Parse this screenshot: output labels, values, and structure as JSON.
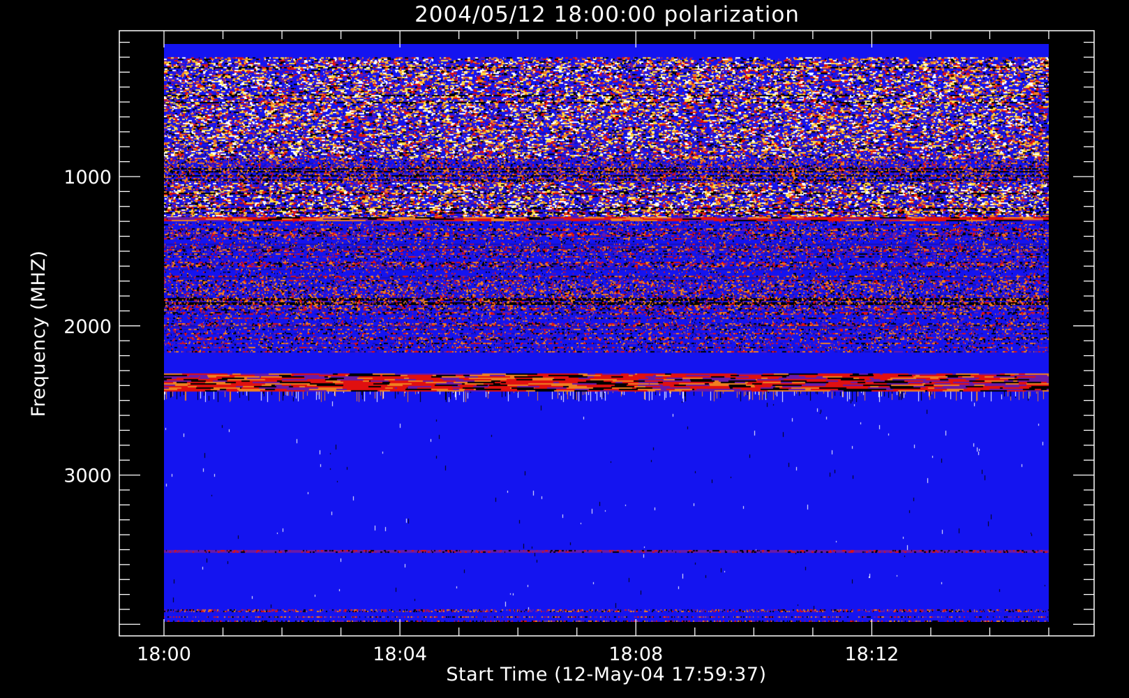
{
  "chart_data": {
    "type": "heatmap",
    "title": "2004/05/12 18:00:00 polarization",
    "xlabel": "Start Time (12-May-04 17:59:37)",
    "ylabel": "Frequency (MHZ)",
    "x_ticks": [
      "18:00",
      "18:04",
      "18:08",
      "18:12"
    ],
    "y_ticks": [
      1000,
      2000,
      3000
    ],
    "xlim_minutes_after_1800": [
      0,
      15
    ],
    "ylim_mhz": [
      100,
      4000
    ],
    "y_axis_orientation": "frequency increases downward",
    "grid": false,
    "legend": "none",
    "colors": {
      "background": "#000000",
      "foreground": "#ffffff",
      "quiet": "#1414f0",
      "deep_blue": "#1a0fb4",
      "purple": "#6a1aa8",
      "red": "#e01010",
      "orange": "#f08020",
      "yellow": "#ffdd44"
    },
    "bands_mhz": [
      {
        "from": 100,
        "to": 200,
        "level": "quiet"
      },
      {
        "from": 200,
        "to": 880,
        "level": "very active"
      },
      {
        "from": 880,
        "to": 1040,
        "level": "active"
      },
      {
        "from": 1040,
        "to": 1270,
        "level": "very active"
      },
      {
        "from": 1270,
        "to": 1300,
        "level": "strong red"
      },
      {
        "from": 1300,
        "to": 1700,
        "level": "mixed"
      },
      {
        "from": 1700,
        "to": 1880,
        "level": "active"
      },
      {
        "from": 1880,
        "to": 2180,
        "level": "mixed"
      },
      {
        "from": 2180,
        "to": 2320,
        "level": "quiet"
      },
      {
        "from": 2320,
        "to": 2440,
        "level": "strong red"
      },
      {
        "from": 2440,
        "to": 3500,
        "level": "quiet sparse"
      },
      {
        "from": 3500,
        "to": 3520,
        "level": "thin line"
      },
      {
        "from": 3520,
        "to": 3900,
        "level": "quiet sparse"
      },
      {
        "from": 3900,
        "to": 3980,
        "level": "noisy bottom"
      }
    ]
  }
}
